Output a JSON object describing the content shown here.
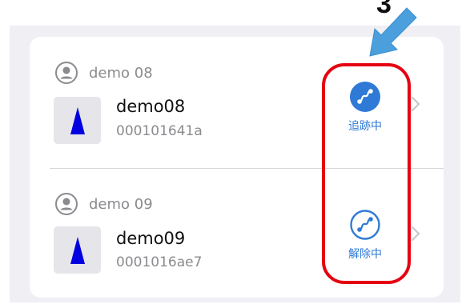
{
  "devices": [
    {
      "owner": "demo 08",
      "name": "demo08",
      "id": "000101641a",
      "status_label": "追跡中",
      "status_icon": "route-icon-filled",
      "accent": "#2f7ad6"
    },
    {
      "owner": "demo 09",
      "name": "demo09",
      "id": "0001016ae7",
      "status_label": "解除中",
      "status_icon": "route-icon-outline",
      "accent": "#2f7ad6"
    }
  ],
  "annotation": {
    "step_number": "3",
    "highlight_color": "#e60012",
    "arrow_color": "#4a9fdc"
  }
}
